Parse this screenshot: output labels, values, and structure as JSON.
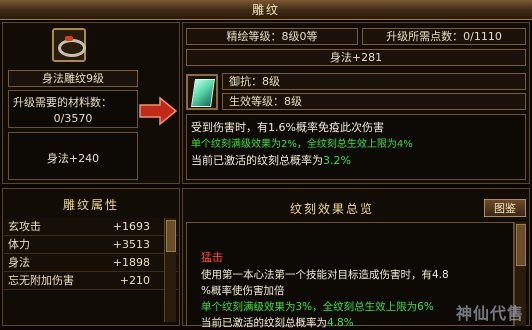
{
  "window": {
    "title": "雕纹"
  },
  "left_panel": {
    "item_name": "身法雕纹9级",
    "materials_label": "升级需要的材料数：",
    "materials_value": "0/3570",
    "stat_value": "身法+240"
  },
  "right_panel": {
    "craft_level": "精绘等级：8级0等",
    "upgrade_points": "升级所需点数：0/1110",
    "stat_value": "身法+281",
    "defense": "御抗：8级",
    "effect_level": "生效等级：8级",
    "desc_line1": "受到伤害时，有1.6%概率免疫此次伤害",
    "desc_line2": "单个纹刻满级效果为2%，全纹刻总生效上限为4%",
    "desc_line3_prefix": "当前已激活的纹刻总概率为",
    "desc_line3_value": "3.2%"
  },
  "attributes": {
    "title": "雕纹属性",
    "items": [
      {
        "name": "玄攻击",
        "value": "+1693"
      },
      {
        "name": "体力",
        "value": "+3513"
      },
      {
        "name": "身法",
        "value": "+1898"
      },
      {
        "name": "忘无附加伤害",
        "value": "+210"
      }
    ]
  },
  "effects_summary": {
    "title": "纹刻效果总览",
    "button_label": "图鉴",
    "entry_title": "猛击",
    "entry_line1": "使用第一本心法第一个技能对目标造成伤害时，有4.8",
    "entry_line2": "%概率使伤害加倍",
    "entry_line3": "单个纹刻满级效果为3%，全纹刻总生效上限为6%",
    "entry_line4_prefix": "当前已激活的纹刻总概率为",
    "entry_line4_value": "4.8%"
  },
  "watermark": "神仙代售",
  "colors": {
    "yellow": "#ffe36a",
    "green": "#37e03a",
    "red": "#ff4a2a",
    "gold_border": "#a88a50"
  }
}
